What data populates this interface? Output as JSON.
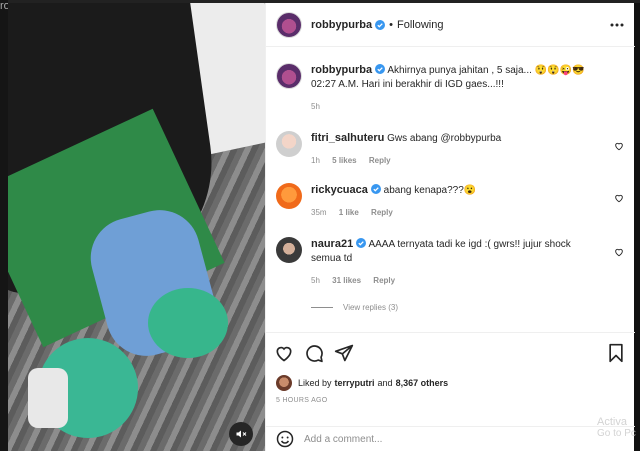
{
  "corner_text": "ro",
  "media": {
    "mute_icon": "speaker-muted-icon"
  },
  "header": {
    "username": "robbypurba",
    "separator": "•",
    "following_label": "Following",
    "more_icon": "more-horizontal-icon"
  },
  "caption": {
    "username": "robbypurba",
    "text": "Akhirnya punya jahitan , 5 saja... 😲😲😜😎02:27 A.M. Hari ini berakhir di IGD gaes...!!!",
    "time": "5h"
  },
  "comments": [
    {
      "username": "fitri_salhuteru",
      "verified": false,
      "text": "Gws abang @robbypurba",
      "time": "1h",
      "likes": "5 likes",
      "reply_label": "Reply"
    },
    {
      "username": "rickycuaca",
      "verified": true,
      "text": "abang kenapa???😮",
      "time": "35m",
      "likes": "1 like",
      "reply_label": "Reply"
    },
    {
      "username": "naura21",
      "verified": true,
      "text": "AAAA ternyata tadi ke igd :( gwrs!! jujur shock semua td",
      "time": "5h",
      "likes": "31 likes",
      "reply_label": "Reply"
    }
  ],
  "view_replies_label": "View replies (3)",
  "actions": {
    "like_icon": "heart-icon",
    "comment_icon": "comment-bubble-icon",
    "share_icon": "paper-plane-icon",
    "save_icon": "bookmark-icon"
  },
  "likes_summary": {
    "prefix": "Liked by",
    "user": "terryputri",
    "conjunction": "and",
    "others": "8,367 others"
  },
  "posted_ago": "5 HOURS AGO",
  "add_comment": {
    "placeholder": "Add a comment...",
    "emoji_icon": "smiley-icon"
  },
  "watermark": {
    "line1": "Activa",
    "line2": "Go to Pc"
  },
  "colors": {
    "verified_blue": "#3897f0",
    "text": "#262626",
    "muted": "#8e8e8e"
  }
}
